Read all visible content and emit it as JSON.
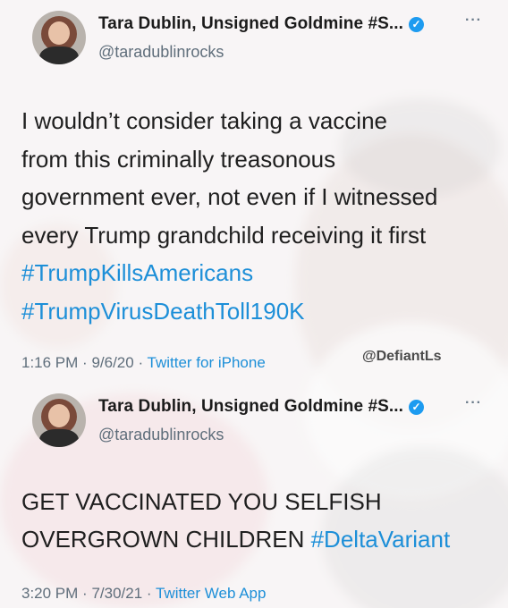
{
  "tweets": [
    {
      "author_name": "Tara Dublin, Unsigned Goldmine #S...",
      "handle": "@taradublinrocks",
      "body_lines": [
        "I wouldn’t consider taking a vaccine",
        "from this criminally treasonous",
        "government ever, not even if I witnessed",
        "every Trump grandchild receiving it first"
      ],
      "hashtags": [
        "#TrumpKillsAmericans",
        "#TrumpVirusDeathToll190K"
      ],
      "time": "1:16 PM",
      "date": "9/6/20",
      "source": "Twitter for iPhone"
    },
    {
      "author_name": "Tara Dublin, Unsigned Goldmine #S...",
      "handle": "@taradublinrocks",
      "body_line1": "GET VACCINATED YOU SELFISH",
      "body_line2": "OVERGROWN CHILDREN",
      "hashtag": "#DeltaVariant",
      "time": "3:20 PM",
      "date": "7/30/21",
      "source": "Twitter Web App"
    }
  ],
  "watermark": "@DefiantLs",
  "icons": {
    "verified": "verified-badge-icon",
    "more": "more-options-icon"
  },
  "colors": {
    "link": "#1d8fd8",
    "verified": "#1d9bf0",
    "secondary_text": "#5f6e7b"
  }
}
